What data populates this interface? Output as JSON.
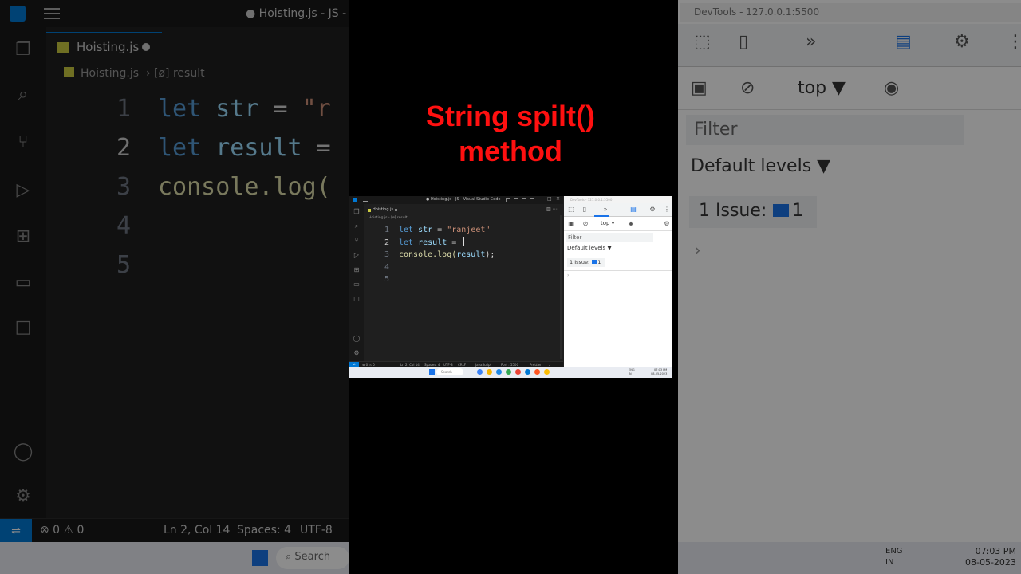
{
  "overlay": {
    "title_line1": "String spilt()",
    "title_line2": "method"
  },
  "vscode": {
    "window_title": "● Hoisting.js - JS - Visual Studio Code",
    "bg_window_title": "● Hoisting.js - JS - Vi",
    "tab": {
      "label": "Hoisting.js"
    },
    "breadcrumb": {
      "file": "Hoisting.js",
      "symbol": "result"
    },
    "code": {
      "line1": {
        "num": "1",
        "kw": "let",
        "var": "str",
        "op": " = ",
        "str": "\"ranjeet\""
      },
      "line2": {
        "num": "2",
        "kw": "let",
        "var": "result",
        "op": " = "
      },
      "line3": {
        "num": "3",
        "fn": "console.log(",
        "var": "result",
        "end": ");"
      },
      "line4": {
        "num": "4"
      },
      "line5": {
        "num": "5"
      }
    },
    "bg_code": {
      "line1": {
        "kw": "let",
        "var": "str",
        "op": " = ",
        "str": "\"r"
      },
      "line2": {
        "kw": "let",
        "var": "result",
        "op": " ="
      },
      "line3": {
        "fn": "console.log("
      }
    },
    "status": {
      "problems": "⊗ 0 ⚠ 0",
      "position": "Ln 2, Col 14",
      "spaces": "Spaces: 4",
      "encoding": "UTF-8",
      "eol": "CRLF",
      "language": "JavaScript",
      "port": "Port : 5500",
      "formatter": "Prettier"
    },
    "accent_color": "#0078d4"
  },
  "devtools": {
    "context": "top",
    "filter_placeholder": "Filter",
    "levels": "Default levels ▼",
    "issues_label": "1 Issue:",
    "issues_count": "1",
    "prompt": "›",
    "bg_title": "DevTools - 127.0.0.1:5500"
  },
  "taskbar": {
    "search": "Search",
    "lang": "ENG",
    "region": "IN",
    "time": "07:03 PM",
    "date": "08-05-2023"
  },
  "icons": {
    "vs_explorer": "files-icon",
    "vs_search": "search-icon",
    "vs_scm": "source-control-icon",
    "vs_run": "run-debug-icon",
    "vs_extensions": "extensions-icon",
    "vs_remote": "remote-explorer-icon",
    "vs_account": "account-icon",
    "vs_settings": "gear-icon",
    "dt_inspect": "inspect-icon",
    "dt_device": "device-toolbar-icon",
    "dt_more": "chevron-double-right-icon",
    "dt_console": "console-icon",
    "dt_settings": "gear-icon",
    "dt_sidebar": "sidebar-icon",
    "dt_clear": "clear-icon",
    "dt_eye": "eye-icon"
  }
}
